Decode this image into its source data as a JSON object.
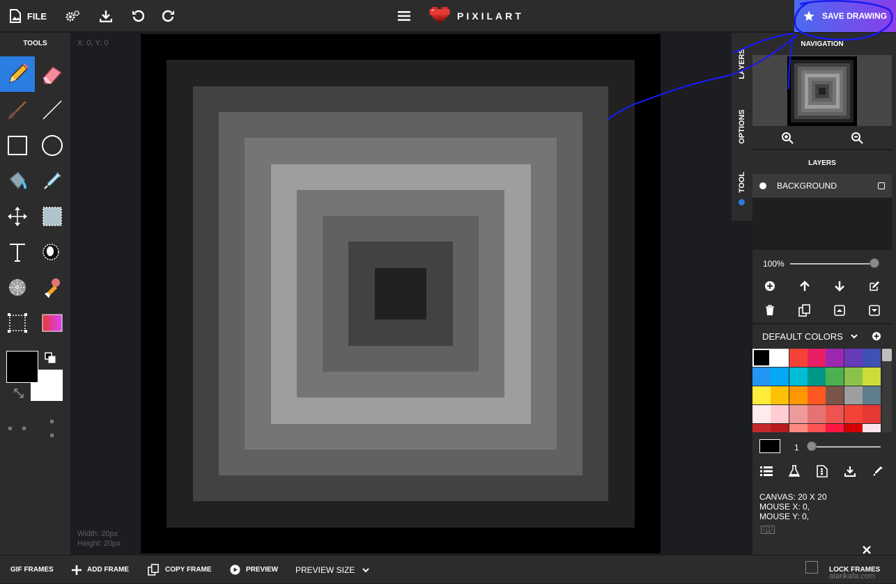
{
  "topbar": {
    "file_label": "FILE",
    "logo_text": "PIXILART",
    "save_label": "SAVE DRAWING"
  },
  "tools": {
    "title": "TOOLS",
    "items": [
      "pencil",
      "eraser",
      "brush",
      "line",
      "rectangle",
      "circle",
      "bucket",
      "eyedropper",
      "move",
      "select",
      "text",
      "dither",
      "checker",
      "stamp",
      "crop",
      "gradient"
    ]
  },
  "colors": {
    "primary": "#000000",
    "secondary": "#ffffff",
    "accent": "#2a7de1"
  },
  "canvas": {
    "coords": "X: 0, Y: 0",
    "width_label": "Width: 20px",
    "height_label": "Height: 20px",
    "rings": [
      "#000000",
      "#212121",
      "#424242",
      "#616161",
      "#757575",
      "#9e9e9e",
      "#757575",
      "#616161",
      "#424242",
      "#212121"
    ]
  },
  "side_tabs": {
    "layers": "LAYERS",
    "options": "OPTIONS",
    "tool": "TOOL"
  },
  "right_panel": {
    "navigation_title": "NAVIGATION",
    "layers_title": "LAYERS",
    "layer_name": "BACKGROUND",
    "opacity": "100%",
    "palette_name": "DEFAULT COLORS",
    "swatches": [
      "#000000",
      "#ffffff",
      "#f44336",
      "#e91e63",
      "#9c27b0",
      "#673ab7",
      "#3f51b5",
      "#2196f3",
      "#03a9f4",
      "#00bcd4",
      "#009688",
      "#4caf50",
      "#8bc34a",
      "#cddc39",
      "#ffeb3b",
      "#ffc107",
      "#ff9800",
      "#ff5722",
      "#795548",
      "#9e9e9e",
      "#607d8b",
      "#ffebee",
      "#ffcdd2",
      "#ef9a9a",
      "#e57373",
      "#ef5350",
      "#f44336",
      "#e53935",
      "#c62828",
      "#b71c1c",
      "#ff8a80",
      "#ff5252",
      "#ff1744",
      "#d50000",
      "#fce4ec"
    ],
    "brush_size": "1",
    "canvas_info": "CANVAS: 20 X 20",
    "mouse_x": "MOUSE X: 0,",
    "mouse_y": "MOUSE Y: 0,"
  },
  "bottombar": {
    "gif_frames": "GIF FRAMES",
    "add_frame": "ADD FRAME",
    "copy_frame": "COPY FRAME",
    "preview": "PREVIEW",
    "preview_size": "PREVIEW SIZE",
    "lock_frames": "LOCK FRAMES"
  },
  "watermark": "atarikafa.com"
}
